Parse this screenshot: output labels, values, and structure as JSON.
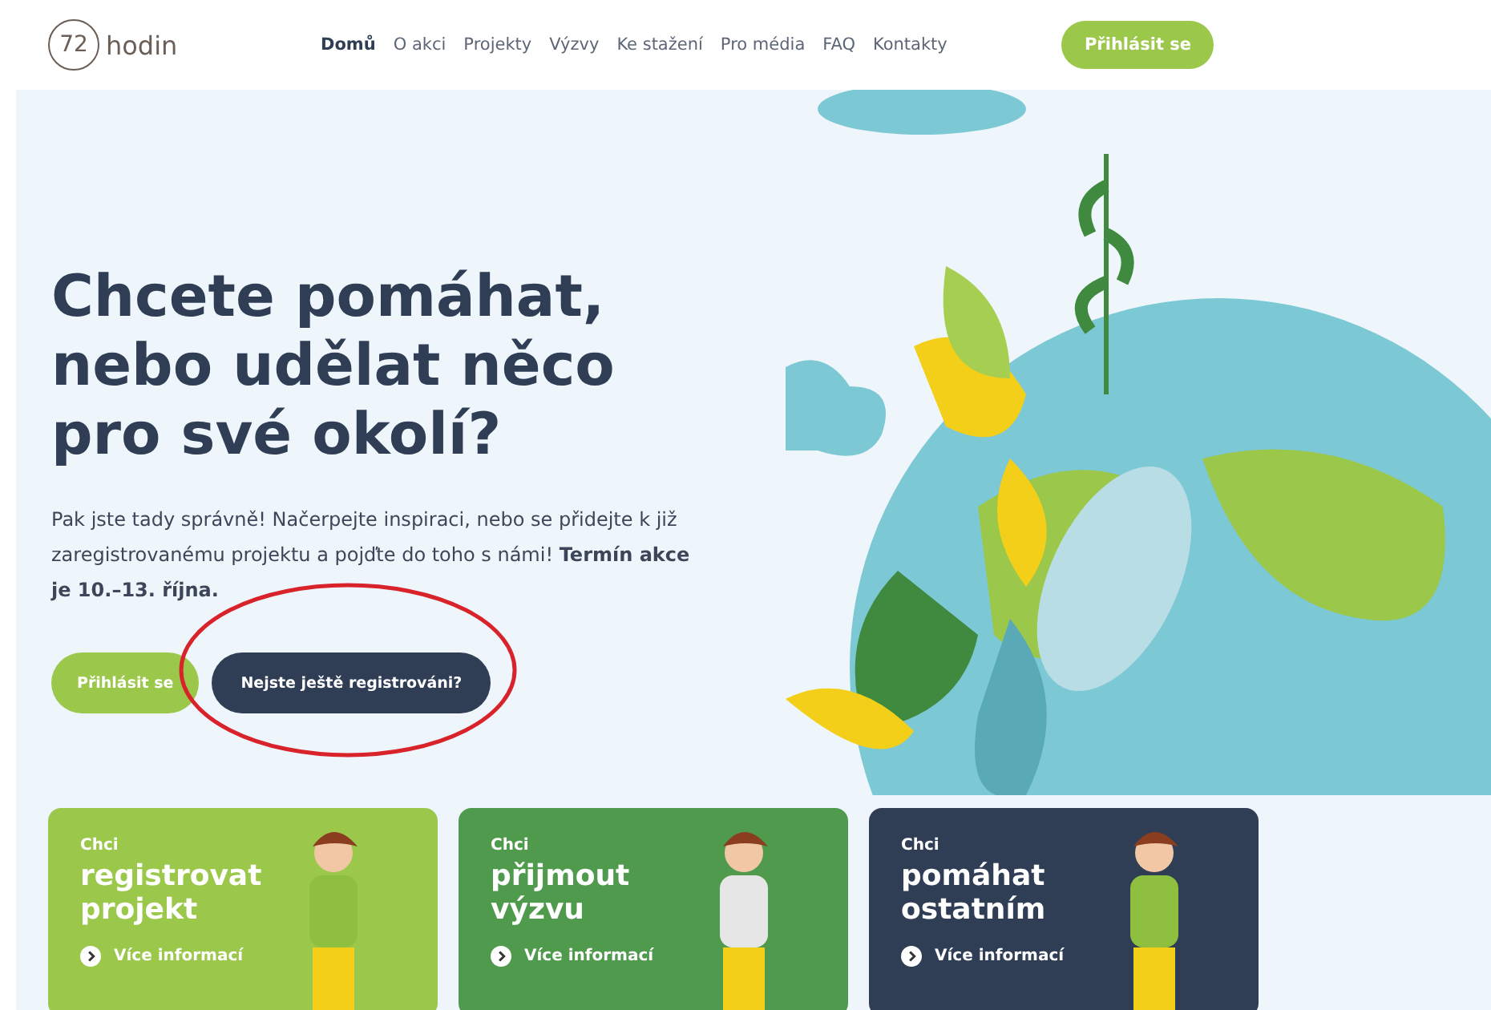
{
  "logo": {
    "number": "72",
    "word": "hodin"
  },
  "nav": [
    {
      "label": "Domů",
      "selected": true
    },
    {
      "label": "O akci",
      "selected": false
    },
    {
      "label": "Projekty",
      "selected": false
    },
    {
      "label": "Výzvy",
      "selected": false
    },
    {
      "label": "Ke stažení",
      "selected": false
    },
    {
      "label": "Pro média",
      "selected": false
    },
    {
      "label": "FAQ",
      "selected": false
    },
    {
      "label": "Kontakty",
      "selected": false
    }
  ],
  "login_button": "Přihlásit se",
  "hero": {
    "heading": "Chcete pomáhat, nebo udělat něco pro své okolí?",
    "text": "Pak jste tady správně! Načerpejte inspiraci, nebo se přidejte k již zaregistrovanému projektu a pojďte do toho s námi! **Termín akce je 10.–13. října.**",
    "primary_button": "Přihlásit se",
    "secondary_button": "Nejste ještě registrováni?"
  },
  "cards": [
    {
      "kicker": "Chci",
      "title": "registrovat projekt",
      "link": "Více informací",
      "color": "#9bc84a"
    },
    {
      "kicker": "Chci",
      "title": "přijmout výzvu",
      "link": "Více informací",
      "color": "#4f9a4d"
    },
    {
      "kicker": "Chci",
      "title": "pomáhat ostatním",
      "link": "Více informací",
      "color": "#2f3d55"
    }
  ]
}
